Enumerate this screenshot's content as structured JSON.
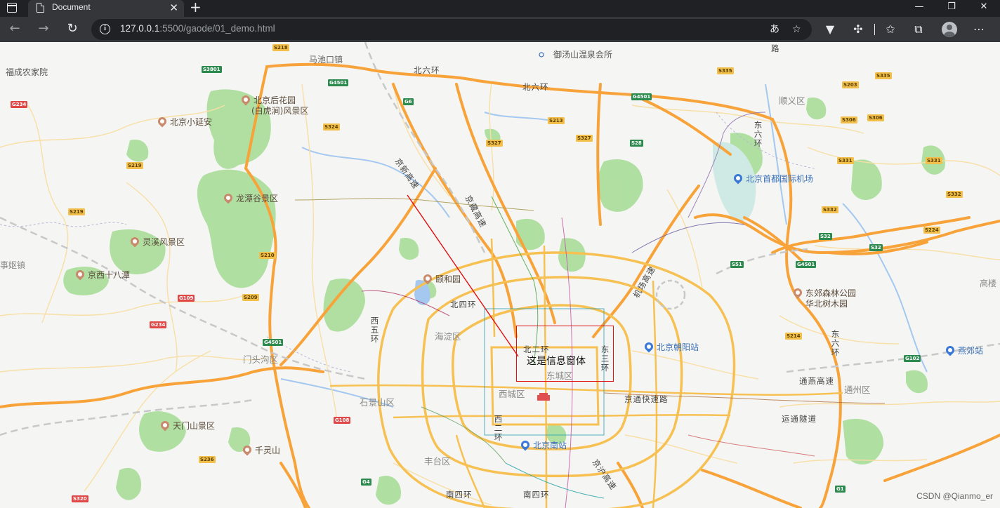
{
  "browser": {
    "tab_title": "Document",
    "tab_close": "✕",
    "new_tab": "+",
    "url_host": "127.0.0.1",
    "url_rest": ":5500/gaode/01_demo.html",
    "icons": [
      "window-icon",
      "tab-favicon",
      "back-icon",
      "forward-icon",
      "reload-icon",
      "info-icon",
      "translate-icon",
      "favorite-add-icon",
      "extension-v-icon",
      "puzzle-icon",
      "favorites-icon",
      "collections-icon",
      "profile-avatar",
      "more-icon",
      "minimize-icon",
      "maximize-icon",
      "close-icon"
    ],
    "colors": {
      "chrome_dark": "#202124",
      "chrome_toolbar": "#35363a",
      "text": "#e8eaed"
    }
  },
  "map": {
    "info_window_text": "这是信息窗体",
    "watermark": "CSDN @Qianmo_er",
    "districts": [
      "海淀区",
      "东城区",
      "西城区",
      "门头沟区",
      "石景山区",
      "丰台区",
      "顺义区",
      "通州区"
    ],
    "pois": {
      "fuchengnongjiayuan": "福成农家院",
      "machikou": "马池口镇",
      "yutangshan": "御汤山温泉会所",
      "houhuayuan_1": "北京后花园",
      "houhuayuan_2": "(白虎涧)风景区",
      "xiaoyanan": "北京小延安",
      "longtangu": "龙潭谷景区",
      "lingxi": "灵溪风景区",
      "jingxi18": "京西十八潭",
      "yiheyuan": "颐和园",
      "tianmenshan": "天门山景区",
      "qianlingshan": "千灵山",
      "airport": "北京首都国际机场",
      "dongjiaosenlin_1": "东郊森林公园",
      "dongjiaosenlin_2": "华北树木园",
      "chaoyang_station": "北京朝阳站",
      "south_station": "北京南站",
      "yanjiao": "燕郊站",
      "gaolou": "高楼",
      "town_left": "事妪镇"
    },
    "roads": {
      "north6_a": "北六环",
      "north6_b": "北六环",
      "north4": "北四环",
      "north2": "北二环",
      "east3": "东三环",
      "west5": "西五环",
      "west2": "西二环",
      "east6": "东六环",
      "east6b": "东六环",
      "south4_a": "南四环",
      "south4_b": "南四环",
      "jingxin": "京新高速",
      "jingcheng": "京藏高速",
      "jichang": "机场高速",
      "jingtong": "京通快速路",
      "tongyan": "通燕高速",
      "yuntong": "运通隧道",
      "jinghu": "京沪高速",
      "lu": "路"
    },
    "shields": [
      "S218",
      "S3801",
      "G4501",
      "G6",
      "S324",
      "S327",
      "S213",
      "S327",
      "S28",
      "G4501",
      "S335",
      "S335",
      "S203",
      "S306",
      "S306",
      "S331",
      "S331",
      "S332",
      "S332",
      "S224",
      "S32",
      "S32",
      "S51",
      "G4501",
      "S214",
      "G102",
      "S219",
      "S219",
      "S210",
      "S209",
      "G109",
      "G234",
      "G234",
      "G4501",
      "G108",
      "S236",
      "G4",
      "S320",
      "G1"
    ]
  }
}
